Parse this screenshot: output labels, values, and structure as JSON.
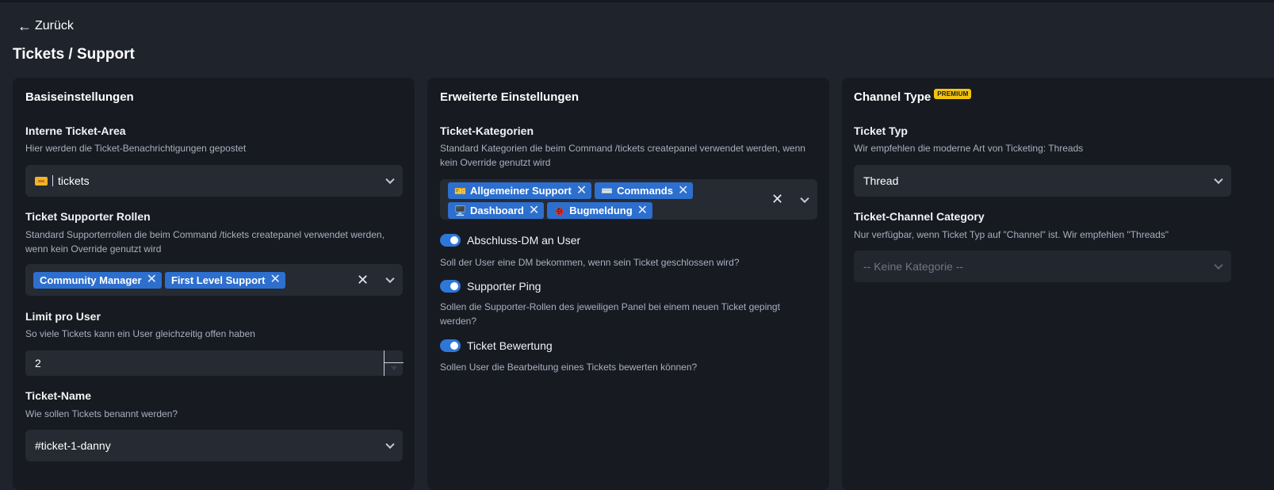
{
  "nav": {
    "back_arrow": "←",
    "back_label": "Zurück"
  },
  "page": {
    "title": "Tickets / Support"
  },
  "basic": {
    "title": "Basiseinstellungen",
    "ticket_area": {
      "label": "Interne Ticket-Area",
      "description": "Hier werden die Ticket-Benachrichtigungen gepostet",
      "icon": "ticket-emoji",
      "value": "tickets"
    },
    "supporter_roles": {
      "label": "Ticket Supporter Rollen",
      "description": "Standard Supporterrollen die beim Command /tickets createpanel verwendet werden, wenn kein Override genutzt wird",
      "tags": [
        "Community Manager",
        "First Level Support"
      ]
    },
    "limit": {
      "label": "Limit pro User",
      "description": "So viele Tickets kann ein User gleichzeitig offen haben",
      "value": "2"
    },
    "ticket_name": {
      "label": "Ticket-Name",
      "description": "Wie sollen Tickets benannt werden?",
      "value": "#ticket-1-danny"
    }
  },
  "advanced": {
    "title": "Erweiterte Einstellungen",
    "categories": {
      "label": "Ticket-Kategorien",
      "description": "Standard Kategorien die beim Command /tickets createpanel verwendet werden, wenn kein Override genutzt wird",
      "tags": [
        {
          "emoji": "🎫",
          "label": "Allgemeiner Support"
        },
        {
          "emoji": "⌨️",
          "label": "Commands"
        },
        {
          "emoji": "🖥️",
          "label": "Dashboard"
        },
        {
          "emoji": "🐞",
          "label": "Bugmeldung"
        }
      ]
    },
    "toggles": [
      {
        "label": "Abschluss-DM an User",
        "description": "Soll der User eine DM bekommen, wenn sein Ticket geschlossen wird?",
        "on": true
      },
      {
        "label": "Supporter Ping",
        "description": "Sollen die Supporter-Rollen des jeweiligen Panel bei einem neuen Ticket gepingt werden?",
        "on": true
      },
      {
        "label": "Ticket Bewertung",
        "description": "Sollen User die Bearbeitung eines Tickets bewerten können?",
        "on": true
      }
    ]
  },
  "channel": {
    "title": "Channel Type",
    "badge": "PREMIUM",
    "ticket_type": {
      "label": "Ticket Typ",
      "description": "Wir empfehlen die moderne Art von Ticketing: Threads",
      "value": "Thread"
    },
    "category": {
      "label": "Ticket-Channel Category",
      "description": "Nur verfügbar, wenn Ticket Typ auf \"Channel\" ist. Wir empfehlen \"Threads\"",
      "placeholder": "-- Keine Kategorie --"
    }
  },
  "colors": {
    "background": "#1f232c",
    "card": "#171a21",
    "input": "#262a33",
    "tag": "#2d6fce",
    "toggle_on": "#2e77d8",
    "premium": "#f2c40f"
  }
}
